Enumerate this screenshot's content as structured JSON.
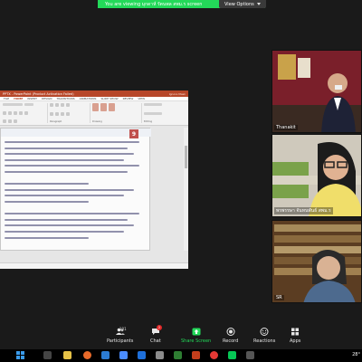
{
  "banner": {
    "text": "You are viewing มุกดาห์ รัตนพล สพม.ร screen",
    "view_options": "View Options"
  },
  "ppt": {
    "title": "PPTX - PowerPoint (Product Activation Failed)",
    "user": "Ignore Mask",
    "tabs": [
      "FILE",
      "HOME",
      "INSERT",
      "DESIGN",
      "TRANSITIONS",
      "ANIMATIONS",
      "SLIDE SHOW",
      "REVIEW",
      "VIEW"
    ],
    "ribbon_groups": [
      "Paragraph",
      "Drawing",
      "Editing"
    ],
    "slide_number": "9"
  },
  "participants": [
    {
      "name": "Thanakit"
    },
    {
      "name": "พรพรรษา จันทนพันธ์ สพม.ร"
    },
    {
      "name": "SR"
    }
  ],
  "toolbar": {
    "participants_label": "Participants",
    "participants_count": "101",
    "chat_label": "Chat",
    "chat_badge": "2",
    "share_label": "Share Screen",
    "record_label": "Record",
    "reactions_label": "Reactions",
    "apps_label": "Apps"
  },
  "taskbar": {
    "time": "28°"
  },
  "colors": {
    "share_green": "#23d959",
    "ppt_red": "#b7472a",
    "badge_red": "#e02828"
  }
}
